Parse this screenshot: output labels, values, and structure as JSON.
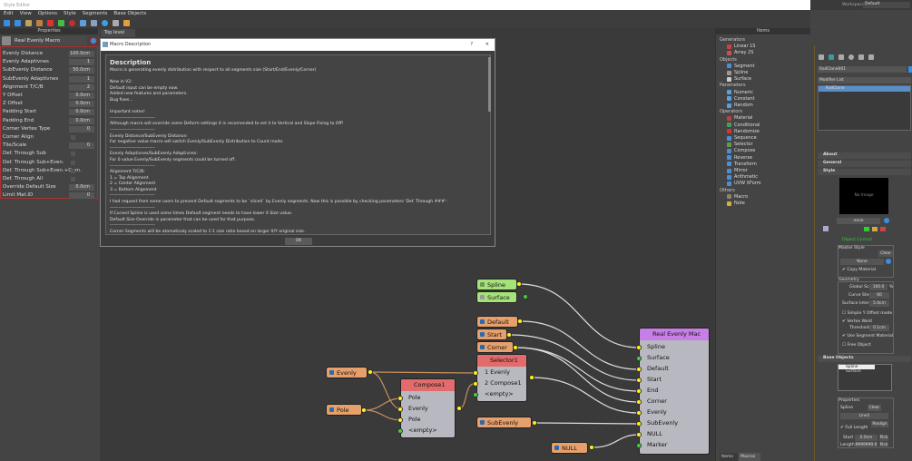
{
  "window": {
    "title": "Style Editor"
  },
  "workspace": {
    "label": "Workspaces:",
    "value": "Default"
  },
  "menu": [
    "Edit",
    "View",
    "Options",
    "Style",
    "Segments",
    "Base Objects"
  ],
  "properties": {
    "header": "Properties",
    "macro_name": "Real Evenly Macro",
    "rows": [
      {
        "label": "Evenly Distance",
        "value": "100.0cm"
      },
      {
        "label": "Evenly Adaptivnes",
        "value": "1"
      },
      {
        "label": "SubEvenly Distance",
        "value": "50.0cm"
      },
      {
        "label": "SubEvenly Adaptivnes",
        "value": "1"
      },
      {
        "label": "Alignment T/C/B",
        "value": "2"
      },
      {
        "label": "Y Offset",
        "value": "0.0cm"
      },
      {
        "label": "Z Offset",
        "value": "0.0cm"
      },
      {
        "label": "Padding Start",
        "value": "0.0cm"
      },
      {
        "label": "Padding End",
        "value": "0.0cm"
      },
      {
        "label": "Corner Vertex Type",
        "value": "0"
      },
      {
        "label": "Corner Align",
        "checked": false
      },
      {
        "label": "Tile/Scale",
        "value": "0"
      },
      {
        "label": "Def. Through Sub",
        "checked": false
      },
      {
        "label": "Def. Through Sub+Even.",
        "checked": false
      },
      {
        "label": "Def. Through Sub+Even.+Corn.",
        "checked": false
      },
      {
        "label": "Def. Through All",
        "checked": false
      },
      {
        "label": "Override Default Size",
        "value": "0.0cm"
      },
      {
        "label": "Limit Mat.ID",
        "value": "0"
      }
    ]
  },
  "canvas": {
    "tab": "Top level"
  },
  "dialog": {
    "title": "Macro Description",
    "help": "?",
    "close": "✕",
    "heading": "Description",
    "ok": "OK",
    "lines": [
      "Macro is generating evenly distribution with respect to all segments size (Start/End/Evenly/Corner)",
      "",
      "New in V2:",
      "Default input can be empty now.",
      "Added new features and parameters.",
      "Bug fixes...",
      "",
      "Important notes!",
      "------------------------------",
      "Although macro will override some Deform settings it is recomended to set it to Vertical and Slope Fixing to Off!",
      "------------------------------",
      "Evenly Distance/SubEvenly Distance:",
      "For negative value macro will switch Evenly/SubEvenly Distribution to Count mode.",
      "------------------------------",
      "Evenly Adaptivnes/SubEvenly Adaptivnes:",
      "For 0 value Evenly/SubEvenly segments could be turned off.",
      "------------------------------",
      "Alignment T/C/B:",
      "1 = Top Alignment",
      "2 = Center Alignment",
      "3 = Bottom Alignment",
      "------------------------------",
      "I had request from some users to prevent Default segments to be `sliced` by Evenly segments. Now this is possible by checking parameters 'Def. Through ###':",
      "------------------------------",
      "If Curved Spline is used some times Default segment needs to have lower X Size value.",
      "Default Size Override is parameter that can be used for that purpose.",
      "------------------------------",
      "Corner Segments will be atomaticaly scaled to 1:1 size ratio based on larger X/Y original size."
    ]
  },
  "items": {
    "header": "Items",
    "tabs": [
      "Items",
      "Macros"
    ],
    "categories": [
      {
        "name": "Generators",
        "items": [
          {
            "label": "Linear 1S",
            "color": "#d04040"
          },
          {
            "label": "Array 2S",
            "color": "#d05050"
          }
        ]
      },
      {
        "name": "Objects",
        "items": [
          {
            "label": "Segment",
            "color": "#4a90d9"
          },
          {
            "label": "Spline",
            "color": "#999999"
          },
          {
            "label": "Surface",
            "color": "#cccccc"
          }
        ]
      },
      {
        "name": "Parameters",
        "items": [
          {
            "label": "Numeric",
            "color": "#5aa0e0"
          },
          {
            "label": "Constant",
            "color": "#5aa0e0"
          },
          {
            "label": "Random",
            "color": "#5aa0e0"
          }
        ]
      },
      {
        "name": "Operators",
        "items": [
          {
            "label": "Material",
            "color": "#c04040"
          },
          {
            "label": "Conditional",
            "color": "#40a060"
          },
          {
            "label": "Randomize",
            "color": "#e03030"
          },
          {
            "label": "Sequence",
            "color": "#4a90d9"
          },
          {
            "label": "Selector",
            "color": "#6a9a40"
          },
          {
            "label": "Compose",
            "color": "#4a90d9"
          },
          {
            "label": "Reverse",
            "color": "#4a90d9"
          },
          {
            "label": "Transform",
            "color": "#4a90d9"
          },
          {
            "label": "Mirror",
            "color": "#4a90d9"
          },
          {
            "label": "Arithmetic",
            "color": "#4a90d9"
          },
          {
            "label": "UVW XForm",
            "color": "#4a90d9"
          }
        ]
      },
      {
        "name": "Others",
        "items": [
          {
            "label": "Macro",
            "color": "#888866"
          },
          {
            "label": "Note",
            "color": "#d0b040"
          }
        ]
      }
    ]
  },
  "nodes": {
    "spline": "Spline",
    "surface": "Surface",
    "default": "Default",
    "start": "Start",
    "corner": "Corner",
    "evenly": "Evenly",
    "pole": "Pole",
    "subevenly": "SubEvenly",
    "null": "NULL",
    "selector": {
      "title": "Selector1",
      "ports": [
        "1  Evenly",
        "2  Compose1",
        "<empty>"
      ]
    },
    "compose": {
      "title": "Compose1",
      "ports": [
        "Pole",
        "Evenly",
        "Pole",
        "<empty>"
      ]
    },
    "macro": {
      "title": "Real Evenly Mac",
      "ports": [
        "Spline",
        "Surface",
        "Default",
        "Start",
        "End",
        "Corner",
        "Evenly",
        "SubEvenly",
        "NULL",
        "Marker"
      ]
    }
  },
  "right": {
    "object_name": "RailClone001",
    "modifier_list": "Modifier List",
    "stack": [
      "RailClone"
    ],
    "rollouts": [
      "About",
      "General",
      "Style"
    ],
    "no_image": "No Image",
    "style_none": "none",
    "object_correct": "Object Correct",
    "master_style": "Master Style",
    "clear": "Clear",
    "master_none": "None",
    "copy_material": "Copy Material",
    "geometry": "Geometry",
    "global_scale_label": "Global Scale",
    "global_scale": "100.0",
    "percent": "%",
    "curve_steps_label": "Curve Steps",
    "curve_steps": "60",
    "surface_interp_label": "Surface Interp.",
    "surface_interp": "5.0cm",
    "simple_y": "Simple Y Offset mode",
    "vertex_weld": "Vertex Weld",
    "threshold_label": "Threshold",
    "threshold": "0.1cm",
    "use_segment_material": "Use Segment Material",
    "free_object": "Free Object",
    "base_objects": "Base Objects",
    "base_list": [
      "Spline",
      "Surface"
    ],
    "props_label": "Properties",
    "spline_label": "Spline",
    "line_value": "Line1",
    "full_length": "Full Length",
    "realign": "Realign",
    "start_label": "Start",
    "start_value": "0.0cm",
    "length_label": "Length",
    "length_value": "9999999.0",
    "pick": "Pick"
  }
}
